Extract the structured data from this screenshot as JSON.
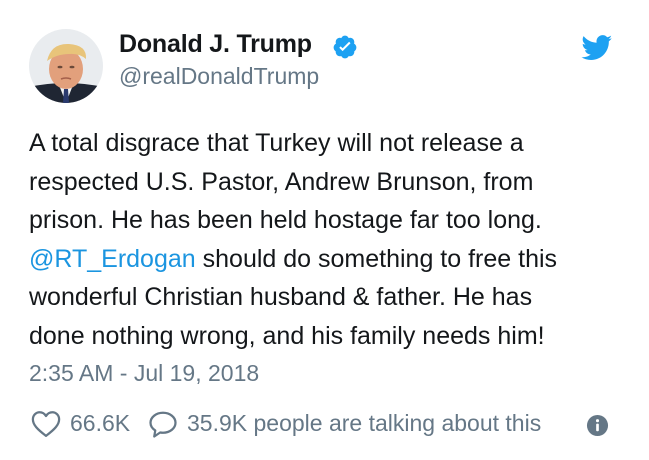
{
  "author": {
    "display_name": "Donald J. Trump",
    "handle": "@realDonaldTrump",
    "avatar_icon": "profile-photo",
    "verified_icon": "verified-badge-icon"
  },
  "tweet": {
    "lines": [
      "A total disgrace that Turkey will not release a",
      "respected U.S. Pastor, Andrew Brunson, from",
      "prison. He has been held hostage far too long.",
      "should do something to free this",
      "wonderful Christian husband & father. He has",
      "done nothing wrong, and his family needs him!"
    ],
    "mention": "@RT_Erdogan",
    "timestamp": "2:35 AM - Jul 19, 2018"
  },
  "stats": {
    "likes": "66.6K",
    "talking": "35.9K people are talking about this"
  },
  "colors": {
    "text": "#14171a",
    "secondary": "#657786",
    "link": "#1b95e0",
    "twitter_blue": "#1da1f2"
  }
}
